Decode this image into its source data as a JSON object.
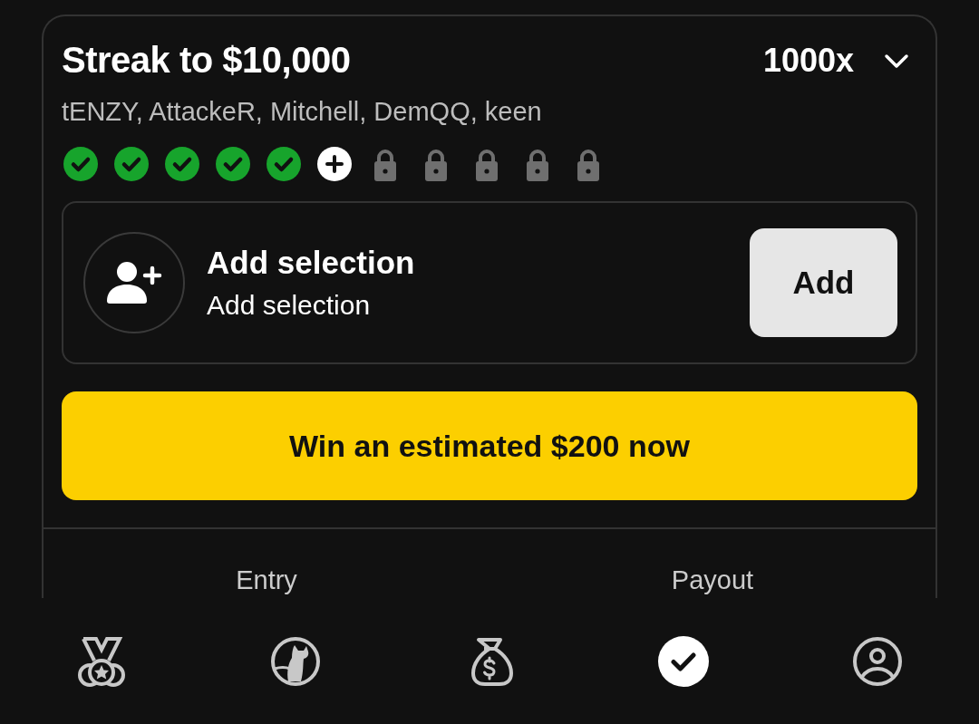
{
  "card": {
    "title": "Streak to $10,000",
    "multiplier": "1000x",
    "expanded": false,
    "players": "tENZY, AttackeR, Mitchell, DemQQ, keen",
    "steps": [
      {
        "kind": "done"
      },
      {
        "kind": "done"
      },
      {
        "kind": "done"
      },
      {
        "kind": "done"
      },
      {
        "kind": "done"
      },
      {
        "kind": "current"
      },
      {
        "kind": "locked"
      },
      {
        "kind": "locked"
      },
      {
        "kind": "locked"
      },
      {
        "kind": "locked"
      },
      {
        "kind": "locked"
      }
    ],
    "selection": {
      "title": "Add selection",
      "subtitle": "Add selection",
      "button": "Add"
    },
    "cta": "Win an estimated $200 now",
    "summary": [
      "Entry",
      "Payout"
    ]
  },
  "nav": [
    {
      "kind": "medal",
      "selected": false
    },
    {
      "kind": "animal",
      "selected": false
    },
    {
      "kind": "money",
      "selected": false
    },
    {
      "kind": "picks",
      "selected": true
    },
    {
      "kind": "profile",
      "selected": false
    }
  ]
}
